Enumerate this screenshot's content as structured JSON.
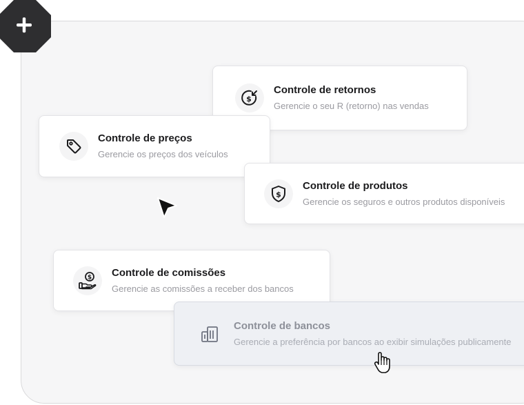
{
  "cards": [
    {
      "title": "Controle de retornos",
      "subtitle": "Gerencie o seu R (retorno) nas vendas",
      "icon": "dollar-return-icon"
    },
    {
      "title": "Controle de preços",
      "subtitle": "Gerencie os preços dos veículos",
      "icon": "price-tag-icon"
    },
    {
      "title": "Controle de produtos",
      "subtitle": "Gerencie os seguros e outros produtos disponíveis",
      "icon": "shield-dollar-icon"
    },
    {
      "title": "Controle de comissões",
      "subtitle": "Gerencie as comissões a receber dos bancos",
      "icon": "hand-coin-icon"
    },
    {
      "title": "Controle de bancos",
      "subtitle": "Gerencie a preferência por bancos ao exibir simulações publicamente",
      "icon": "bank-building-icon"
    }
  ],
  "badge": {
    "icon": "plus-icon"
  },
  "cursors": [
    "arrow-cursor-icon",
    "hand-pointer-cursor-icon"
  ]
}
